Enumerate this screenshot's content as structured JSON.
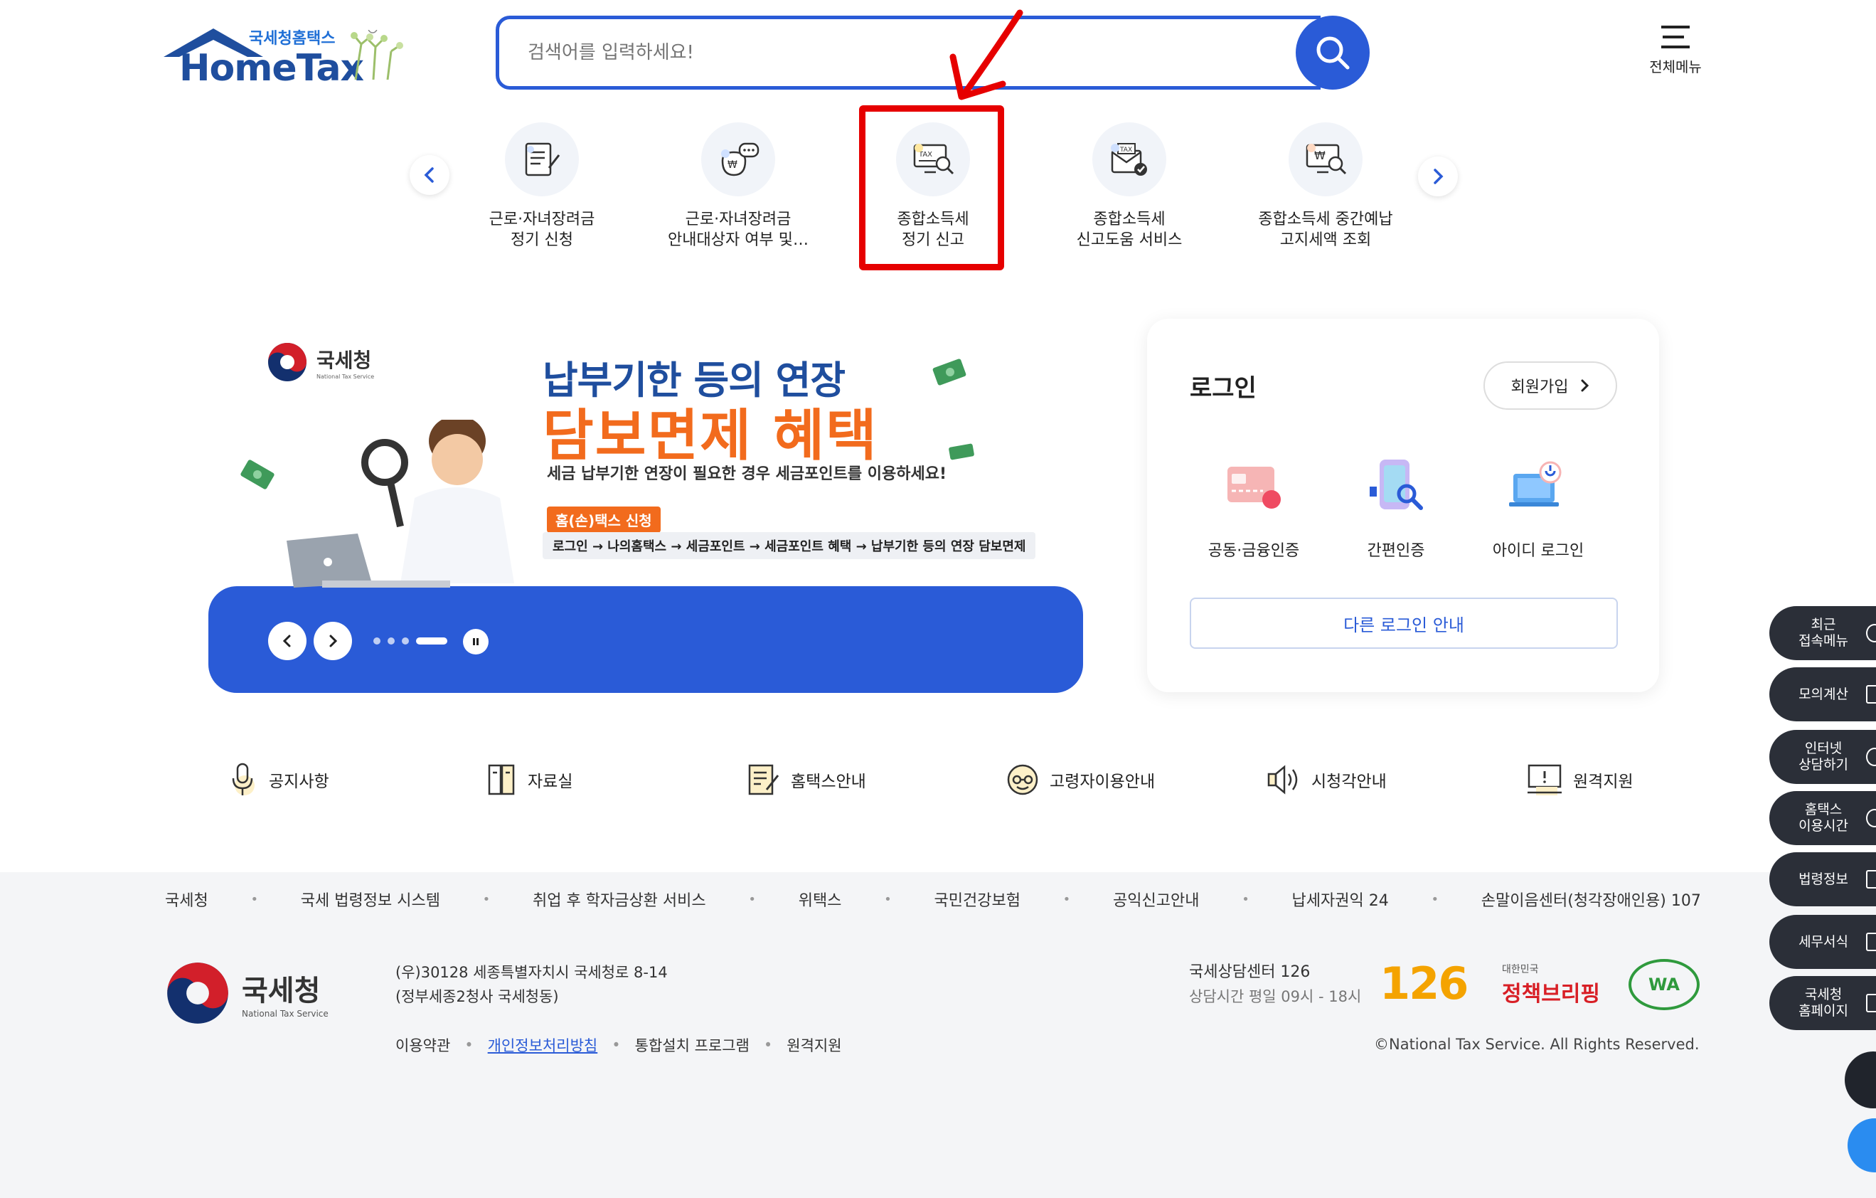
{
  "header": {
    "brand_sub": "국세청홈택스",
    "brand_main": "HomeTax",
    "search_placeholder": "검색어를 입력하세요!",
    "all_menu_label": "전체메뉴"
  },
  "quick_menu": {
    "items": [
      {
        "line1": "근로·자녀장려금",
        "line2": "정기 신청",
        "icon": "form-pen-icon"
      },
      {
        "line1": "근로·자녀장려금",
        "line2": "안내대상자 여부 및…",
        "icon": "money-bag-chat-icon"
      },
      {
        "line1": "종합소득세",
        "line2": "정기 신고",
        "icon": "tax-monitor-search-icon"
      },
      {
        "line1": "종합소득세",
        "line2": "신고도움 서비스",
        "icon": "tax-envelope-check-icon"
      },
      {
        "line1": "종합소득세 중간예납",
        "line2": "고지세액 조회",
        "icon": "won-monitor-search-icon"
      }
    ]
  },
  "banner": {
    "agency": "국세청",
    "agency_en": "National Tax Service",
    "title1": "납부기한 등의 연장",
    "title2": "담보면제 혜택",
    "subtitle": "세금 납부기한 연장이 필요한 경우 세금포인트를 이용하세요!",
    "tag": "홈(손)택스 신청",
    "steps": "로그인 → 나의홈택스 → 세금포인트 → 세금포인트 혜택 → 납부기한 등의 연장 담보면제"
  },
  "login": {
    "title": "로그인",
    "join_label": "회원가입",
    "methods": [
      {
        "label": "공동·금융인증",
        "icon": "certificate-card-icon"
      },
      {
        "label": "간편인증",
        "icon": "phone-search-icon"
      },
      {
        "label": "아이디 로그인",
        "icon": "id-login-monitor-icon"
      }
    ],
    "other_login": "다른 로그인 안내"
  },
  "bottom_menu": [
    {
      "label": "공지사항",
      "icon": "microphone-icon"
    },
    {
      "label": "자료실",
      "icon": "file-cabinet-icon"
    },
    {
      "label": "홈택스안내",
      "icon": "document-edit-icon"
    },
    {
      "label": "고령자이용안내",
      "icon": "elder-face-icon"
    },
    {
      "label": "시청각안내",
      "icon": "speaker-icon"
    },
    {
      "label": "원격지원",
      "icon": "remote-monitor-icon"
    }
  ],
  "footer": {
    "links": [
      "국세청",
      "국세 법령정보 시스템",
      "취업 후 학자금상환 서비스",
      "위택스",
      "국민건강보험",
      "공익신고안내",
      "납세자권익 24",
      "손말이음센터(청각장애인용) 107"
    ],
    "agency": "국세청",
    "agency_en": "National Tax Service",
    "address_line1": "(우)30128 세종특별자치시 국세청로 8-14",
    "address_line2": "(정부세종2청사 국세청동)",
    "sub_links": {
      "terms": "이용약관",
      "privacy": "개인정보처리방침",
      "install": "통합설치 프로그램",
      "remote": "원격지원"
    },
    "center_title": "국세상담센터 126",
    "center_hours": "상담시간 평일 09시 - 18시",
    "logo_126": "126",
    "policy_logo_small": "대한민국",
    "policy_logo": "정책브리핑",
    "wa_logo": "WA",
    "copyright": "©National Tax Service. All Rights Reserved."
  },
  "side_panel": [
    {
      "line1": "최근",
      "line2": "접속메뉴",
      "icon": "clock-icon"
    },
    {
      "line1": "모의계산",
      "line2": "",
      "icon": "calculator-icon"
    },
    {
      "line1": "인터넷",
      "line2": "상담하기",
      "icon": "chat-icon"
    },
    {
      "line1": "홈택스",
      "line2": "이용시간",
      "icon": "time-icon"
    },
    {
      "line1": "법령정보",
      "line2": "",
      "icon": "gavel-icon"
    },
    {
      "line1": "세무서식",
      "line2": "",
      "icon": "form-icon"
    },
    {
      "line1": "국세청",
      "line2": "홈페이지",
      "icon": "home-icon"
    }
  ],
  "colors": {
    "primary": "#2a5bd7",
    "navy": "#1f4e9e",
    "orange": "#f26b1d",
    "annotation": "#e60000",
    "side_panel": "#2b2f38"
  }
}
